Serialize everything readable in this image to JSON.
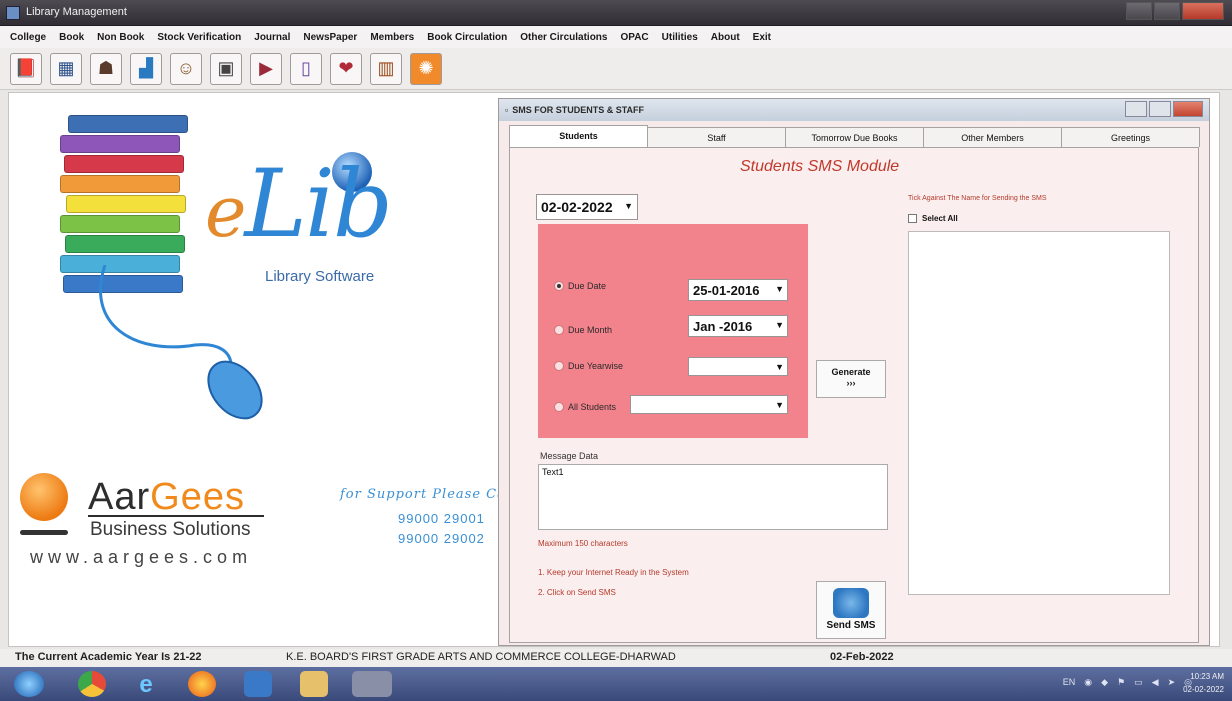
{
  "window": {
    "title": "Library Management"
  },
  "menu": [
    "College",
    "Book",
    "Non Book",
    "Stock Verification",
    "Journal",
    "NewsPaper",
    "Members",
    "Book Circulation",
    "Other Circulations",
    "OPAC",
    "Utilities",
    "About",
    "Exit"
  ],
  "toolbar_icons": [
    "book-icon",
    "calendar-icon",
    "user-icon",
    "chart-icon",
    "member-icon",
    "screen-icon",
    "bookmark-icon",
    "document-icon",
    "heart-icon",
    "book-open-icon",
    "orange-icon"
  ],
  "branding": {
    "elib_e": "e",
    "elib_lib": "Lib",
    "tagline": "Library Software",
    "company_aar": "Aar",
    "company_gees": "Gees",
    "company_sub": "Business Solutions",
    "website": "www.aargees.com",
    "support": "for Support Please Ca",
    "phone1": "99000 29001",
    "phone2": "99000 29002"
  },
  "sms": {
    "title": "SMS FOR STUDENTS & STAFF",
    "tabs": [
      "Students",
      "Staff",
      "Tomorrow Due Books",
      "Other Members",
      "Greetings"
    ],
    "module_title": "Students SMS Module",
    "top_date": "02-02-2022",
    "options": {
      "due_date_label": "Due Date",
      "due_date_value": "25-01-2016",
      "due_month_label": "Due Month",
      "due_month_value": "Jan -2016",
      "due_yearwise_label": "Due Yearwise",
      "all_students_label": "All Students"
    },
    "generate_label": "Generate",
    "generate_arrows": "›››",
    "message_label": "Message Data",
    "message_text": "Text1",
    "max_chars": "Maximum 150 characters",
    "step1": "1. Keep your Internet Ready in the System",
    "step2": "2. Click on Send SMS",
    "send_label": "Send SMS",
    "tick_label": "Tick Against The Name for Sending the SMS",
    "select_all": "Select All"
  },
  "status": {
    "academic_year": "The Current Academic Year Is 21-22",
    "college": "K.E. BOARD'S FIRST GRADE ARTS AND COMMERCE COLLEGE-DHARWAD",
    "date": "02-Feb-2022"
  },
  "taskbar": {
    "lang": "EN",
    "time": "10:23 AM",
    "date": "02-02-2022"
  }
}
